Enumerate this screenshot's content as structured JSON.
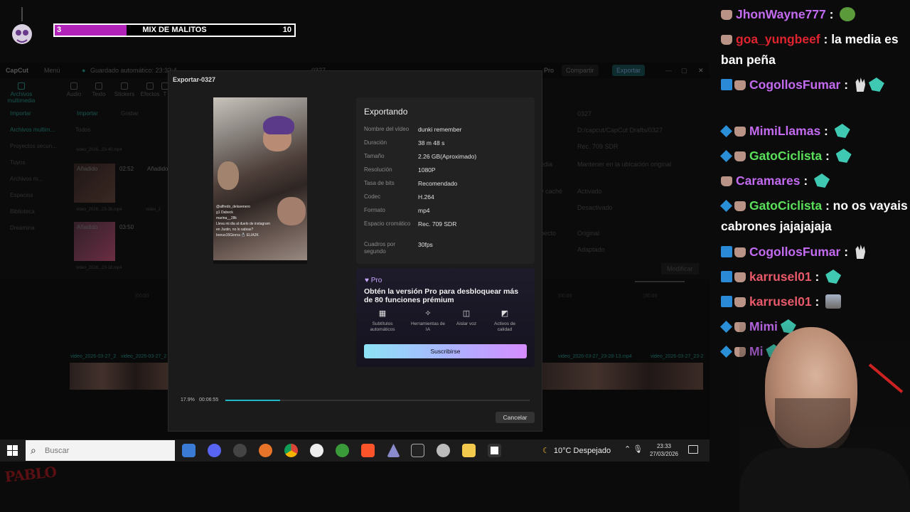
{
  "overlay": {
    "goal": {
      "current": "3",
      "title": "MIX DE MALITOS",
      "max": "10",
      "progress": 0.3,
      "fill_color": "#b123b8"
    }
  },
  "capcut": {
    "titlebar": {
      "app": "CapCut",
      "menu": "Menú",
      "autosave": "Guardado automático: 23:32:4",
      "project": "0327",
      "pro": "Pro",
      "share": "Compartir",
      "export": "Exportar"
    },
    "tools": [
      "Archivos multimedia",
      "Audio",
      "Texto",
      "Stickers",
      "Efectos",
      "T"
    ],
    "sidebar": [
      "Importar",
      "Archivos multim...",
      "Proyectos secun...",
      "Tuyos",
      "Archivos m...",
      "Espacios",
      "Biblioteca",
      "Dreamina"
    ],
    "media": {
      "import": "Importar",
      "record": "Grabar",
      "all": "Todos",
      "added": "Añadido",
      "clip1_dur": "02:52",
      "clip2_dur": "03:50",
      "clip0": "video_2026...23-40.mp4",
      "clip1": "video_2026...23-36.mp4",
      "clip2": "video_2026...23-18.mp4",
      "clip3": "video_2"
    },
    "right": {
      "name": "0327",
      "path": "D:/capcut/CapCut Drafts/0327",
      "color": "Rec. 709 SDR",
      "media": "Mantener en la ubicación original",
      "on": "Activado",
      "off": "Desactivado",
      "original": "Original",
      "adapted": "Adaptado",
      "modify": "Modificar",
      "lbl_media": "edia",
      "lbl_proxy": "y caché",
      "lbl_aspect": "pecto"
    },
    "timeline": {
      "clip_a": "video_2026-03-27_2",
      "clip_b": "video_2026-03-27_2",
      "clip_c": "video_2026-03-27_23-28-13.mp4",
      "clip_d": "video_2026-03-27_23-2",
      "mark_a": "|00:00",
      "mark_b": "|00:00",
      "mark_c": "|30:00"
    }
  },
  "dialog": {
    "title": "Exportar-0327",
    "heading": "Exportando",
    "rows": [
      {
        "label": "Nombre del vídeo",
        "value": "dunki remember"
      },
      {
        "label": "Duración",
        "value": "38 m 48 s"
      },
      {
        "label": "Tamaño",
        "value": "2.26 GB(Aproximado)"
      },
      {
        "label": "Resolución",
        "value": "1080P"
      },
      {
        "label": "Tasa de bits",
        "value": "Recomendado"
      },
      {
        "label": "Codec",
        "value": "H.264"
      },
      {
        "label": "Formato",
        "value": "mp4"
      },
      {
        "label": "Espacio cromático",
        "value": "Rec. 709 SDR"
      },
      {
        "label": "Cuadros por segundo",
        "value": "30fps"
      }
    ],
    "preview_chat": [
      "@alfredo_delavenero",
      "g1 Dabeck",
      "marina__28k",
      "Lleva mi dia al duelo de instagram",
      "en Justin, no lo sabias?",
      "bonus15Giorca  💍 ELIA2K"
    ],
    "pro": {
      "badge": "Pro",
      "headline": "Obtén la versión Pro para desbloquear más de 80 funciones prémium",
      "features": [
        {
          "icon": "subtitles-icon",
          "label": "Subtítulos automáticos"
        },
        {
          "icon": "ai-tools-icon",
          "label": "Herramientas de IA"
        },
        {
          "icon": "voice-isolate-icon",
          "label": "Aislar voz"
        },
        {
          "icon": "quality-assets-icon",
          "label": "Activos de calidad"
        }
      ],
      "subscribe": "Suscribirse"
    },
    "progress": {
      "percent_text": "17.9%",
      "elapsed": "00:06:55",
      "fraction": 0.179
    },
    "cancel": "Cancelar"
  },
  "taskbar": {
    "search_placeholder": "Buscar",
    "weather": "10°C  Despejado",
    "time": "23:33",
    "date": "27/03/2026",
    "apps": [
      "microsoft-store-icon",
      "discord-icon",
      "obs-icon",
      "firefox-icon",
      "chrome-icon",
      "media-player-icon",
      "xbox-icon",
      "brave-icon",
      "app-icon",
      "terminal-icon",
      "steam-icon",
      "file-explorer-icon",
      "capcut-icon"
    ]
  },
  "watermark": "PABLO",
  "chat": [
    {
      "user": "JhonWayne777",
      "color": "#c36bf0",
      "badges": [
        "hand"
      ],
      "text": ":",
      "emotes": [
        "pepe"
      ]
    },
    {
      "user": "goa_yungbeef",
      "color": "#e0242f",
      "badges": [
        "hand"
      ],
      "text": ": la media es ban peña",
      "emotes": []
    },
    {
      "user": "CogollosFumar",
      "color": "#c36bf0",
      "badges": [
        "pro",
        "hand"
      ],
      "text": ":",
      "emotes": [
        "hand",
        "gem"
      ]
    },
    {
      "user": "MimiLlamas",
      "color": "#c36bf0",
      "badges": [
        "cube",
        "hand"
      ],
      "text": ":",
      "emotes": [
        "gem"
      ]
    },
    {
      "user": "GatoCiclista",
      "color": "#5be05b",
      "badges": [
        "cube",
        "hand"
      ],
      "text": ":",
      "emotes": [
        "gem"
      ]
    },
    {
      "user": "Caramares",
      "color": "#c36bf0",
      "badges": [
        "hand"
      ],
      "text": ":",
      "emotes": [
        "gem"
      ]
    },
    {
      "user": "GatoCiclista",
      "color": "#5be05b",
      "badges": [
        "cube",
        "hand"
      ],
      "text": ": no os vayais cabrones jajajajaja",
      "emotes": []
    },
    {
      "user": "CogollosFumar",
      "color": "#c36bf0",
      "badges": [
        "pro",
        "hand"
      ],
      "text": ":",
      "emotes": [
        "hand"
      ]
    },
    {
      "user": "karrusel01",
      "color": "#e85a6a",
      "badges": [
        "pro",
        "hand"
      ],
      "text": ":",
      "emotes": [
        "gem"
      ]
    },
    {
      "user": "karrusel01",
      "color": "#e85a6a",
      "badges": [
        "pro",
        "hand"
      ],
      "text": ":",
      "emotes": [
        "face"
      ]
    },
    {
      "user": "Mimi",
      "color": "#c36bf0",
      "badges": [
        "cube",
        "hand"
      ],
      "text": "",
      "emotes": [
        "gem"
      ]
    },
    {
      "user": "Mi",
      "color": "#c36bf0",
      "badges": [
        "cube",
        "hand"
      ],
      "text": "",
      "emotes": [
        "gem"
      ]
    }
  ]
}
